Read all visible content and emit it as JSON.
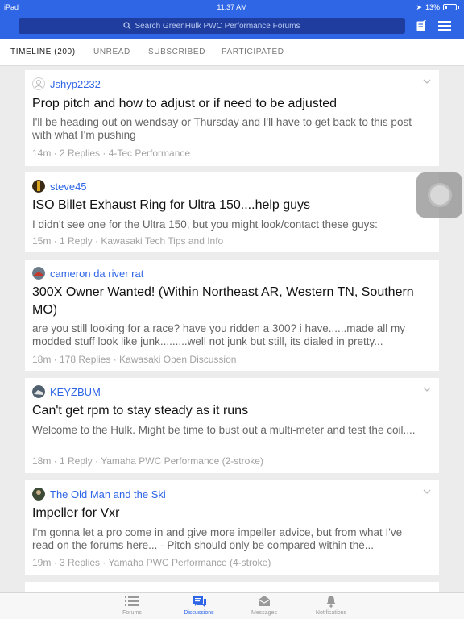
{
  "status_bar": {
    "device": "iPad",
    "time": "11:37 AM",
    "battery": "13%"
  },
  "search": {
    "placeholder": "Search GreenHulk PWC Performance Forums"
  },
  "tabs": [
    {
      "label": "TIMELINE (200)"
    },
    {
      "label": "UNREAD"
    },
    {
      "label": "SUBSCRIBED"
    },
    {
      "label": "PARTICIPATED"
    }
  ],
  "threads": [
    {
      "username": "Jshyp2232",
      "title": "Prop pitch and how to adjust or if need to be adjusted",
      "excerpt": "I'll be heading out on wendsay or Thursday and I'll have to get back to this post with what I'm pushing",
      "meta": "14m · 2 Replies · 4-Tec Performance"
    },
    {
      "username": "steve45",
      "title": "ISO Billet Exhaust Ring for Ultra 150....help guys",
      "excerpt": "I didn't see one for the Ultra 150, but you might look/contact these guys:",
      "meta": "15m · 1 Reply · Kawasaki Tech Tips and Info"
    },
    {
      "username": "cameron da river rat",
      "title": "300X Owner Wanted! (Within Northeast AR, Western TN, Southern MO)",
      "excerpt": "are you still looking for a race? have you ridden a 300? i have......made all my modded stuff look like junk.........well not junk but still, its dialed in pretty...",
      "meta": "18m · 178 Replies · Kawasaki Open Discussion"
    },
    {
      "username": "KEYZBUM",
      "title": "Can't get rpm to stay steady as it runs",
      "excerpt": "Welcome to the Hulk. Might be time to bust out a multi-meter and test the coil....",
      "meta": "18m · 1 Reply · Yamaha PWC Performance (2-stroke)"
    },
    {
      "username": "The Old Man and the Ski",
      "title": "Impeller for Vxr",
      "excerpt": "I'm gonna let a pro come in and give more impeller advice, but from what I've read on the forums here... - Pitch should only be compared within the...",
      "meta": "19m · 3 Replies · Yamaha PWC Performance (4-stroke)"
    }
  ],
  "bottom_nav": [
    {
      "label": "Forums",
      "icon": "list-icon"
    },
    {
      "label": "Discussions",
      "icon": "chat-bubbles-icon"
    },
    {
      "label": "Messages",
      "icon": "envelope-icon"
    },
    {
      "label": "Notifications",
      "icon": "bell-icon"
    }
  ],
  "colors": {
    "brand": "#2f66e6",
    "search_bg": "#1f3d9e",
    "background": "#ececec"
  }
}
